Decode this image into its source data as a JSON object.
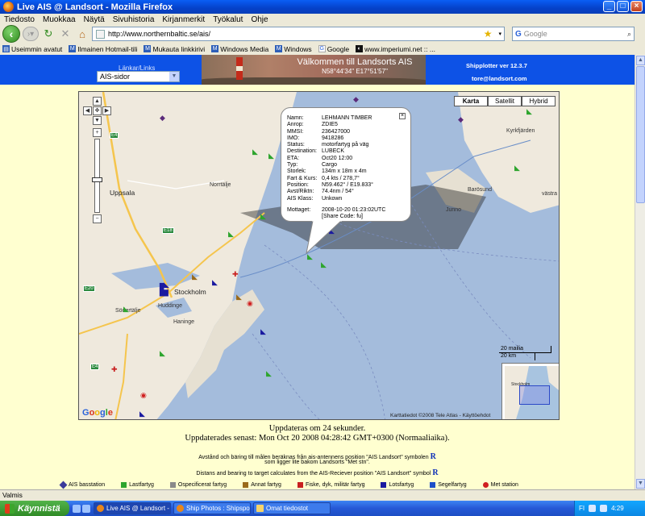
{
  "window": {
    "title": "Live AIS @ Landsort - Mozilla Firefox",
    "minimize": "_",
    "maximize": "□",
    "close": "×"
  },
  "menu": [
    "Tiedosto",
    "Muokkaa",
    "Näytä",
    "Sivuhistoria",
    "Kirjanmerkit",
    "Työkalut",
    "Ohje"
  ],
  "nav": {
    "url": "http://www.northernbaltic.se/ais/",
    "search_placeholder": "Google"
  },
  "bookmarks": [
    "Useimmin avatut",
    "Ilmainen Hotmail-tili",
    "Mukauta linkkirivi",
    "Windows Media",
    "Windows",
    "Google",
    "www.imperiumi.net :: ..."
  ],
  "header": {
    "links_label": "Länkar/Links",
    "links_select": "AIS-sidor",
    "banner_title": "Välkommen till Landsorts AIS",
    "banner_coords": "N58°44'34\" E17°51'57\"",
    "shipplotter": "Shipplotter ver 12.3.7",
    "email": "tore@landsort.com"
  },
  "map": {
    "types": [
      "Karta",
      "Satellit",
      "Hybrid"
    ],
    "active_type": "Karta",
    "places": {
      "uppsala": "Uppsala",
      "norrtalje": "Norrtälje",
      "stockholm": "Stockholm",
      "sodertalje": "Södertälje",
      "huddinge": "Huddinge",
      "haninge": "Haninge",
      "barosund": "Barösund",
      "kyrkfjarden": "Kyrkfjärden",
      "junno": "Junno",
      "vastra": "västra",
      "e4": "E4",
      "e18": "E18",
      "e20": "E20"
    },
    "scale_top": "20 mailia",
    "scale_bottom": "20 km",
    "overview_label": "Stockholm",
    "copyright": "Karttatiedot ©2008 Tele Atlas - Käyttöehdot",
    "google": "Google"
  },
  "info": {
    "rows": [
      {
        "k": "Namn:",
        "v": "LEHMANN TIMBER"
      },
      {
        "k": "Anrop:",
        "v": "ZDIE5"
      },
      {
        "k": "MMSI:",
        "v": "236427000"
      },
      {
        "k": "IMO:",
        "v": "9418286"
      },
      {
        "k": "Status:",
        "v": "motorfartyg på väg"
      },
      {
        "k": "Destination:",
        "v": "LUBECK"
      },
      {
        "k": "ETA:",
        "v": "Oct20 12:00"
      },
      {
        "k": "Typ:",
        "v": "Cargo"
      },
      {
        "k": "Storlek:",
        "v": "134m x 18m x 4m"
      },
      {
        "k": "Fart & Kurs:",
        "v": "0,4 kts / 278,7°"
      },
      {
        "k": "Position:",
        "v": "N59.462° / E19.833°"
      },
      {
        "k": "Avst/Riktn:",
        "v": "74.4nm / 54°"
      },
      {
        "k": "AIS Klass:",
        "v": "Unkown"
      }
    ],
    "mottaget_label": "Mottaget:",
    "mottaget_value": "2008-10-20 01:23:02UTC",
    "share": "[Share Code: fu]"
  },
  "content": {
    "update1": "Uppdateras om 24 sekunder.",
    "update2": "Uppdaterades senast: Mon Oct 20 2008 04:28:42 GMT+0300 (Normaaliaika).",
    "note1": "Avstånd och bäring till målen beräknas från ais-antennens position \"AIS Landsort\" symbolen",
    "note2": "som ligger lite bakom Landsorts \"Met stn\".",
    "note3": "Distans and bearing to target calculates from the AIS-Reciever position \"AIS Landsort\" symbol",
    "r": "R"
  },
  "legend": [
    {
      "label": "AIS basstation",
      "color": "#3b3b9a"
    },
    {
      "label": "Lastfartyg",
      "color": "#2ea52e"
    },
    {
      "label": "Ospecificerat fartyg",
      "color": "#8a8a8a"
    },
    {
      "label": "Annat fartyg",
      "color": "#9a6a1a"
    },
    {
      "label": "Fiske, dyk, militär fartyg",
      "color": "#c82020"
    },
    {
      "label": "Lotsfartyg",
      "color": "#1a1aa0"
    },
    {
      "label": "Segelfartyg",
      "color": "#1d4fc8"
    },
    {
      "label": "Met station",
      "color": "#d02020"
    }
  ],
  "status": "Valmis",
  "taskbar": {
    "start": "Käynnistä",
    "items": [
      "Live AIS @ Landsort - ...",
      "Ship Photos : Shipspo...",
      "Omat tiedostot"
    ],
    "lang": "FI",
    "clock": "4:29"
  }
}
